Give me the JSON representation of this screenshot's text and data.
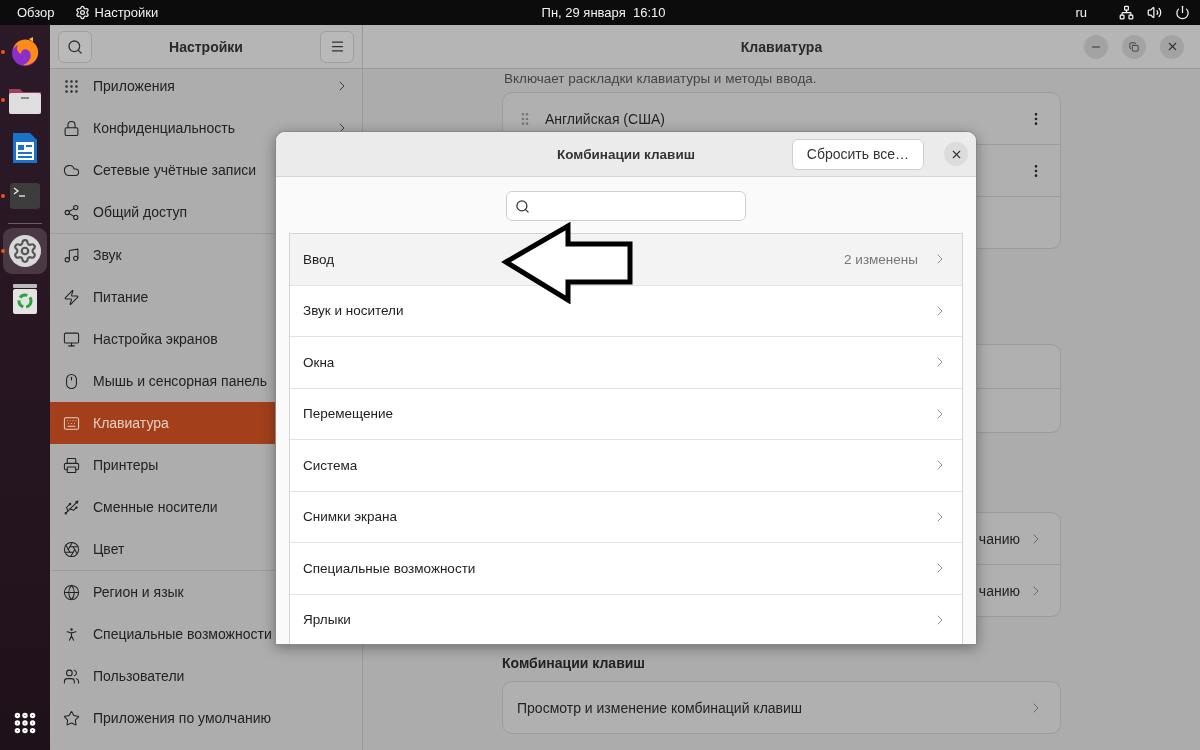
{
  "top_bar": {
    "activities": "Обзор",
    "app_name": "Настройки",
    "clock": "Пн, 29 января  16:10",
    "keyboard_layout": "ru"
  },
  "dock": {
    "items": [
      {
        "running": true,
        "active": false
      },
      {
        "running": true,
        "active": false
      },
      {
        "running": false,
        "active": false
      },
      {
        "running": true,
        "active": false
      },
      {
        "running": true,
        "active": true
      },
      {
        "running": false,
        "active": false
      }
    ]
  },
  "sidebar": {
    "title": "Настройки",
    "groups": [
      {
        "items": [
          {
            "label": "Приложения",
            "arrow": true,
            "selected": false
          },
          {
            "label": "Конфиденциальность",
            "arrow": true,
            "selected": false
          },
          {
            "label": "Сетевые учётные записи",
            "arrow": false,
            "selected": false
          },
          {
            "label": "Общий доступ",
            "arrow": false,
            "selected": false
          }
        ]
      },
      {
        "items": [
          {
            "label": "Звук",
            "arrow": false,
            "selected": false
          },
          {
            "label": "Питание",
            "arrow": false,
            "selected": false
          },
          {
            "label": "Настройка экранов",
            "arrow": false,
            "selected": false
          },
          {
            "label": "Мышь и сенсорная панель",
            "arrow": false,
            "selected": false
          },
          {
            "label": "Клавиатура",
            "arrow": false,
            "selected": true
          },
          {
            "label": "Принтеры",
            "arrow": false,
            "selected": false
          },
          {
            "label": "Сменные носители",
            "arrow": false,
            "selected": false
          },
          {
            "label": "Цвет",
            "arrow": false,
            "selected": false
          }
        ]
      },
      {
        "items": [
          {
            "label": "Регион и язык",
            "arrow": false,
            "selected": false
          },
          {
            "label": "Специальные возможности",
            "arrow": false,
            "selected": false
          },
          {
            "label": "Пользователи",
            "arrow": false,
            "selected": false
          },
          {
            "label": "Приложения по умолчанию",
            "arrow": false,
            "selected": false
          }
        ]
      }
    ]
  },
  "main": {
    "title": "Клавиатура",
    "description": "Включает раскладки клавиатуры и методы ввода.",
    "cards": [
      {
        "rows": [
          {
            "kind": "layout",
            "label": "Английская (США)"
          },
          {
            "kind": "layout"
          },
          {
            "kind": "blank"
          }
        ]
      },
      {
        "rows": [
          {
            "kind": "blank"
          },
          {
            "kind": "blank"
          }
        ]
      },
      {
        "rows": [
          {
            "kind": "link",
            "label": "чанию"
          },
          {
            "kind": "link",
            "label": "чанию"
          }
        ]
      },
      {
        "heading": "Комбинации клавиш",
        "rows": [
          {
            "kind": "link",
            "label": "Просмотр и изменение комбинаций клавиш"
          }
        ]
      }
    ]
  },
  "dialog": {
    "title": "Комбинации клавиш",
    "reset_button": "Сбросить все…",
    "categories": [
      {
        "label": "Ввод",
        "note": "2 изменены",
        "highlighted": true
      },
      {
        "label": "Звук и носители",
        "highlighted": false
      },
      {
        "label": "Окна",
        "highlighted": false
      },
      {
        "label": "Перемещение",
        "highlighted": false
      },
      {
        "label": "Система",
        "highlighted": false
      },
      {
        "label": "Снимки экрана",
        "highlighted": false
      },
      {
        "label": "Специальные возможности",
        "highlighted": false
      },
      {
        "label": "Ярлыки",
        "highlighted": false
      }
    ]
  }
}
